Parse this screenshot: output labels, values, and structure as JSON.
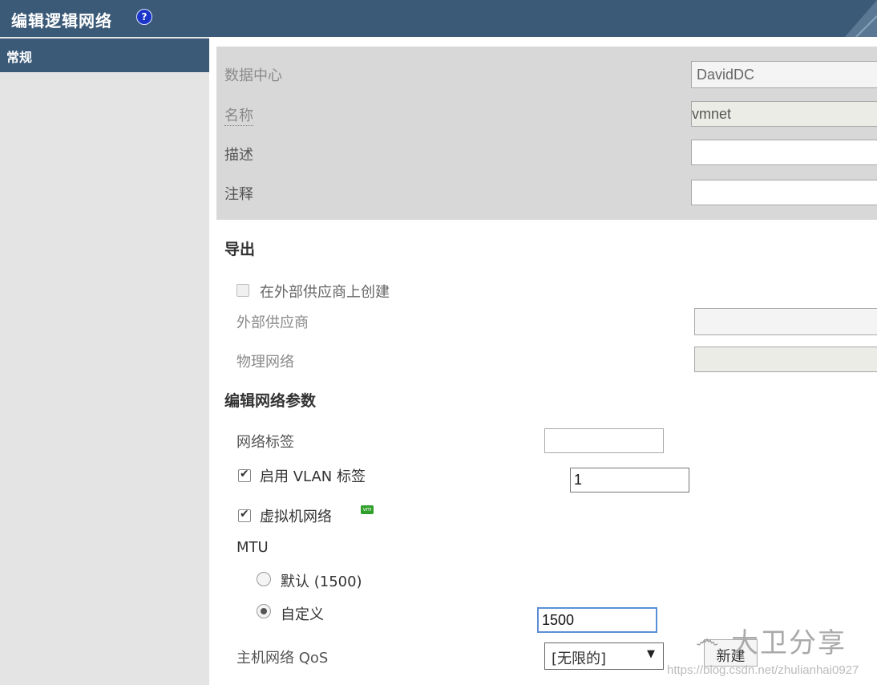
{
  "dialog": {
    "title": "编辑逻辑网络",
    "help_glyph": "?"
  },
  "sidebar": {
    "items": [
      {
        "label": "常规",
        "selected": true
      }
    ]
  },
  "general": {
    "datacenter": {
      "label": "数据中心",
      "value": "DavidDC"
    },
    "name": {
      "label": "名称",
      "value": "vmnet"
    },
    "description": {
      "label": "描述",
      "value": ""
    },
    "comment": {
      "label": "注释",
      "value": ""
    }
  },
  "export": {
    "title": "导出",
    "create_on_external": {
      "label": "在外部供应商上创建",
      "checked": false
    },
    "external_provider": {
      "label": "外部供应商",
      "value": ""
    },
    "physical_network": {
      "label": "物理网络",
      "value": ""
    }
  },
  "network_params": {
    "title": "编辑网络参数",
    "network_label": {
      "label": "网络标签",
      "value": ""
    },
    "vlan": {
      "label": "启用 VLAN 标签",
      "checked": true,
      "value": "1"
    },
    "vm_network": {
      "label": "虚拟机网络",
      "checked": true,
      "badge": "vm"
    },
    "mtu": {
      "label": "MTU",
      "default_option": "默认 (1500)",
      "custom_option": "自定义",
      "selected": "custom",
      "custom_value": "1500"
    },
    "host_qos": {
      "label": "主机网络 QoS",
      "selected": "[无限的]",
      "new_button": "新建"
    }
  },
  "watermark": {
    "text": "大卫分享",
    "url": "https://blog.csdn.net/zhulianhai0927"
  },
  "colors": {
    "header": "#3a5a78",
    "nav_bg": "#e4e4e4",
    "panel": "#d8d8d8"
  },
  "icons": {
    "help": "help-icon",
    "checkbox": "check-icon",
    "vm": "vm-icon",
    "dropdown": "chevron-down-icon"
  }
}
